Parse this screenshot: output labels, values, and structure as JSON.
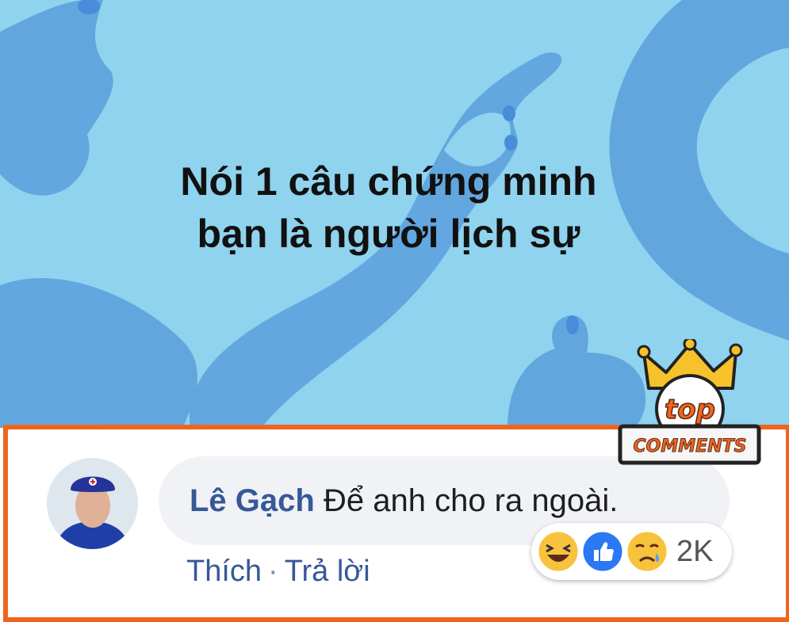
{
  "headline": {
    "line1": "Nói 1 câu chứng minh",
    "line2": "bạn là người lịch sự"
  },
  "badge": {
    "top_label": "top",
    "comments_label": "COMMENTS"
  },
  "comment": {
    "author": "Lê Gạch",
    "text": "Để anh cho ra ngoài.",
    "reaction_count": "2K",
    "reactions": [
      "haha-icon",
      "like-icon",
      "sad-icon"
    ]
  },
  "actions": {
    "like_label": "Thích",
    "separator": "·",
    "reply_label": "Trả lời"
  },
  "colors": {
    "hero_bg": "#8fd3ee",
    "hand_shape": "#5b9fdc",
    "frame_orange": "#f0651d",
    "author_blue": "#365899",
    "bubble_gray": "#f1f2f5"
  }
}
